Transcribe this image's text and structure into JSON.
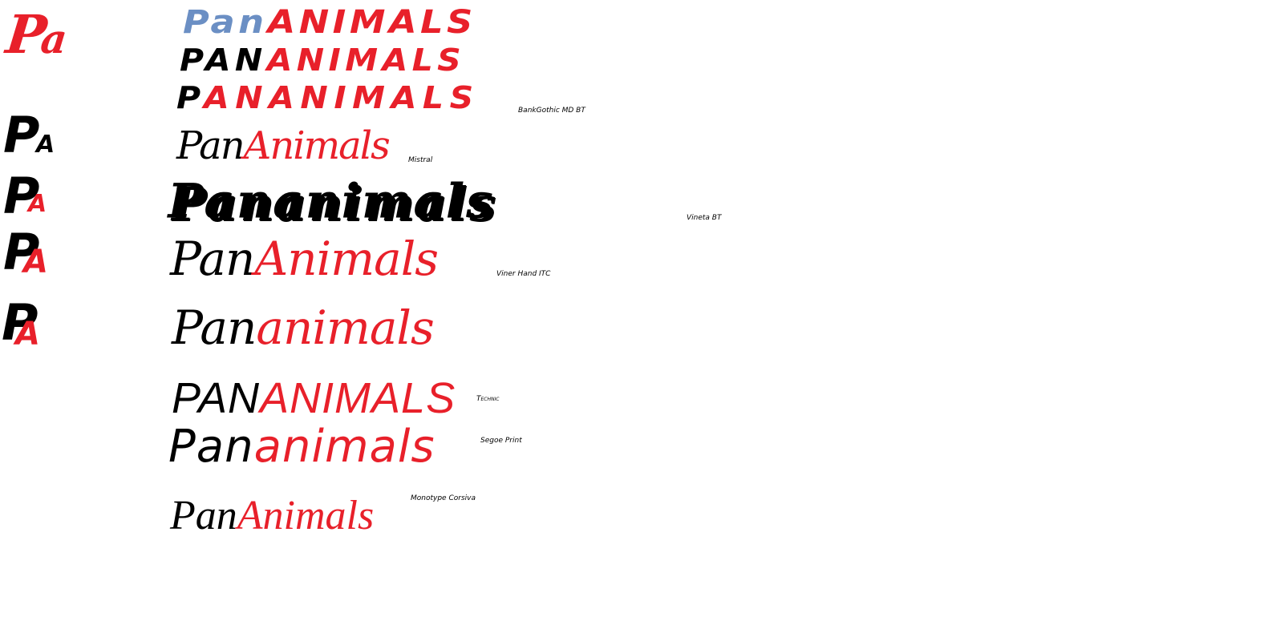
{
  "monograms": {
    "m1": {
      "p": "P",
      "a": "a"
    },
    "m2": {
      "p": "P",
      "a": "A"
    },
    "m3": {
      "p": "P",
      "a": "A"
    },
    "m4": {
      "p": "P",
      "a": "A"
    },
    "m5": {
      "p": "P",
      "a": "A"
    }
  },
  "rows": [
    {
      "part1": "Pan",
      "part2": "animals",
      "label": ""
    },
    {
      "part1": "Pan",
      "part2": "animals",
      "label": ""
    },
    {
      "part1": "P",
      "part2": "ananimals",
      "label": "BankGothic MD BT"
    },
    {
      "part1": "Pan",
      "part2": "Animals",
      "label": "Mistral"
    },
    {
      "part1": "Pananimals",
      "part2": "",
      "label": "Vineta BT"
    },
    {
      "part1": "Pan",
      "part2": "Animals",
      "label": "Viner Hand ITC"
    },
    {
      "part1": "Pan",
      "part2": "animals",
      "label": ""
    },
    {
      "part1": "Pan",
      "part2": "Animals",
      "label": "Technic"
    },
    {
      "part1": "Pan",
      "part2": "animals",
      "label": "Segoe Print"
    },
    {
      "part1": "Pan",
      "part2": "Animals",
      "label": "Monotype Corsiva"
    }
  ],
  "colors": {
    "black": "#000000",
    "red": "#e8202a",
    "blue": "#6b8fc4"
  }
}
